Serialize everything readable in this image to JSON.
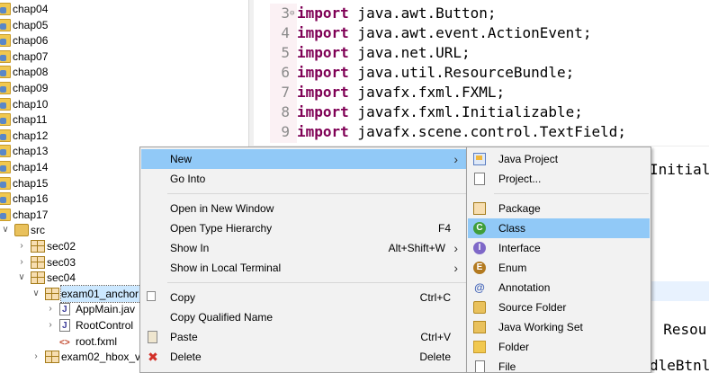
{
  "tree": {
    "items": [
      {
        "label": "chap04",
        "depth": 0,
        "icon": "project-folder-icon"
      },
      {
        "label": "chap05",
        "depth": 0,
        "icon": "project-folder-icon"
      },
      {
        "label": "chap06",
        "depth": 0,
        "icon": "project-folder-icon"
      },
      {
        "label": "chap07",
        "depth": 0,
        "icon": "project-folder-icon"
      },
      {
        "label": "chap08",
        "depth": 0,
        "icon": "project-folder-icon"
      },
      {
        "label": "chap09",
        "depth": 0,
        "icon": "project-folder-icon"
      },
      {
        "label": "chap10",
        "depth": 0,
        "icon": "project-folder-icon"
      },
      {
        "label": "chap11",
        "depth": 0,
        "icon": "project-folder-icon"
      },
      {
        "label": "chap12",
        "depth": 0,
        "icon": "project-folder-icon"
      },
      {
        "label": "chap13",
        "depth": 0,
        "icon": "project-folder-icon"
      },
      {
        "label": "chap14",
        "depth": 0,
        "icon": "project-folder-icon"
      },
      {
        "label": "chap15",
        "depth": 0,
        "icon": "project-folder-icon"
      },
      {
        "label": "chap16",
        "depth": 0,
        "icon": "project-folder-icon"
      },
      {
        "label": "chap17",
        "depth": 0,
        "icon": "project-folder-icon"
      },
      {
        "label": "src",
        "depth": 0,
        "icon": "source-folder-icon",
        "expanded": true
      },
      {
        "label": "sec02",
        "depth": 1,
        "icon": "package-icon",
        "expanded": false
      },
      {
        "label": "sec03",
        "depth": 1,
        "icon": "package-icon",
        "expanded": false
      },
      {
        "label": "sec04",
        "depth": 1,
        "icon": "package-icon",
        "expanded": true
      },
      {
        "label": "exam01_anchor",
        "depth": 2,
        "icon": "package-icon",
        "expanded": true,
        "selected": true
      },
      {
        "label": "AppMain.jav",
        "depth": 3,
        "icon": "java-file-icon",
        "expanded": false
      },
      {
        "label": "RootControl",
        "depth": 3,
        "icon": "java-file-icon",
        "expanded": false
      },
      {
        "label": "root.fxml",
        "depth": 3,
        "icon": "fxml-file-icon"
      },
      {
        "label": "exam02_hbox_v",
        "depth": 2,
        "icon": "package-icon",
        "expanded": false
      }
    ]
  },
  "editor": {
    "lines": [
      {
        "num": "3",
        "kw": "import",
        "code": " java.awt.Button;",
        "fold": true
      },
      {
        "num": "4",
        "kw": "import",
        "code": " java.awt.event.ActionEvent;"
      },
      {
        "num": "5",
        "kw": "import",
        "code": " java.net.URL;"
      },
      {
        "num": "6",
        "kw": "import",
        "code": " java.util.ResourceBundle;"
      },
      {
        "num": "7",
        "kw": "import",
        "code": " javafx.fxml.FXML;"
      },
      {
        "num": "8",
        "kw": "import",
        "code": " javafx.fxml.Initializable;"
      },
      {
        "num": "9",
        "kw": "import",
        "code": " javafx.scene.control.TextField;"
      }
    ],
    "fragments": [
      {
        "text": "Initial",
        "name": "code-fragment-initial"
      },
      {
        "text": ", Resou",
        "name": "code-fragment-resou"
      },
      {
        "text": "dleBtnl",
        "name": "code-fragment-dlebtnl"
      }
    ]
  },
  "context_menu": {
    "items": [
      {
        "label": "New",
        "submenu": true,
        "hover": true
      },
      {
        "label": "Go Into"
      },
      {
        "separator": true
      },
      {
        "label": "Open in New Window"
      },
      {
        "label": "Open Type Hierarchy",
        "shortcut": "F4"
      },
      {
        "label": "Show In",
        "shortcut": "Alt+Shift+W",
        "submenu": true
      },
      {
        "label": "Show in Local Terminal",
        "submenu": true
      },
      {
        "separator": true
      },
      {
        "label": "Copy",
        "shortcut": "Ctrl+C",
        "icon": "copy-icon"
      },
      {
        "label": "Copy Qualified Name",
        "icon": "copy-qualified-name-icon"
      },
      {
        "label": "Paste",
        "shortcut": "Ctrl+V",
        "icon": "paste-icon"
      },
      {
        "label": "Delete",
        "shortcut": "Delete",
        "icon": "delete-icon"
      }
    ]
  },
  "submenu": {
    "items": [
      {
        "label": "Java Project",
        "icon": "java-project-icon"
      },
      {
        "label": "Project...",
        "icon": "project-icon"
      },
      {
        "separator": true
      },
      {
        "label": "Package",
        "icon": "package-icon"
      },
      {
        "label": "Class",
        "icon": "class-icon",
        "hover": true
      },
      {
        "label": "Interface",
        "icon": "interface-icon"
      },
      {
        "label": "Enum",
        "icon": "enum-icon"
      },
      {
        "label": "Annotation",
        "icon": "annotation-icon"
      },
      {
        "label": "Source Folder",
        "icon": "source-folder-icon"
      },
      {
        "label": "Java Working Set",
        "icon": "working-set-icon"
      },
      {
        "label": "Folder",
        "icon": "folder-icon"
      },
      {
        "label": "File",
        "icon": "file-icon"
      }
    ]
  },
  "colors": {
    "keyword": "#7f0055",
    "menu_hover": "#91c9f7",
    "tree_selection": "#cce8ff",
    "menu_background": "#f2f2f2"
  }
}
